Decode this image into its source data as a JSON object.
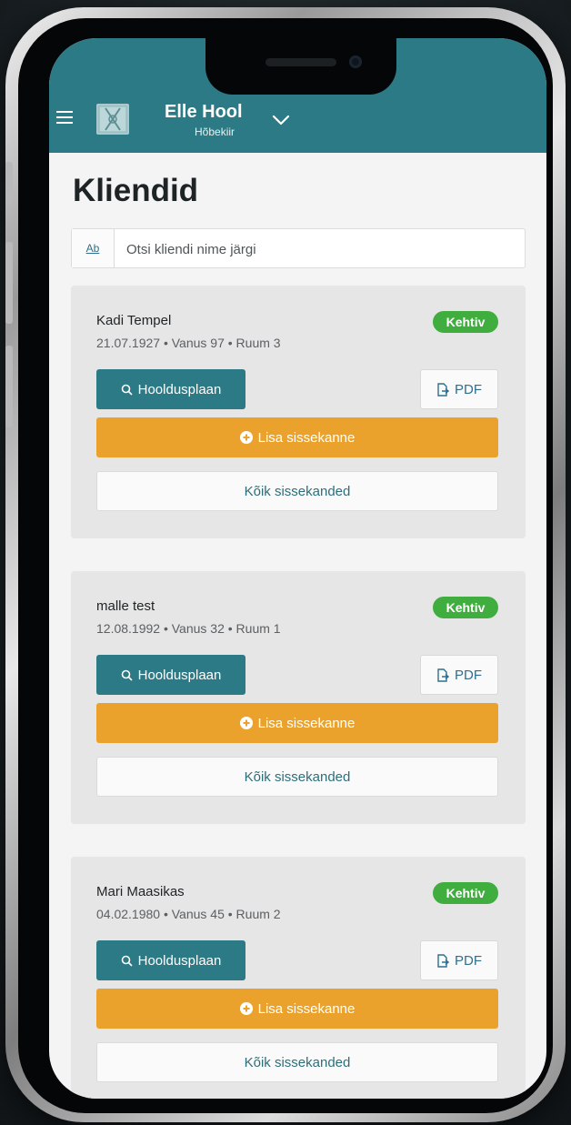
{
  "header": {
    "user_name": "Elle Hool",
    "organization": "Hõbekiir",
    "menu_icon": "hamburger-menu-icon",
    "chevron_icon": "chevron-down-icon",
    "background_color": "#2c7a85"
  },
  "page": {
    "title": "Kliendid"
  },
  "search": {
    "prefix_label": "Ab",
    "placeholder": "Otsi kliendi nime järgi",
    "value": ""
  },
  "clients": [
    {
      "name": "Kadi Tempel",
      "meta": "21.07.1927 • Vanus 97 • Ruum 3",
      "status": "Kehtiv",
      "care_plan_label": "Hooldusplaan",
      "pdf_label": "PDF",
      "add_entry_label": "Lisa sissekanne",
      "all_entries_label": "Kõik sissekanded"
    },
    {
      "name": "malle test",
      "meta": "12.08.1992 • Vanus 32 • Ruum 1",
      "status": "Kehtiv",
      "care_plan_label": "Hooldusplaan",
      "pdf_label": "PDF",
      "add_entry_label": "Lisa sissekanne",
      "all_entries_label": "Kõik sissekanded"
    },
    {
      "name": "Mari Maasikas",
      "meta": "04.02.1980 • Vanus 45 • Ruum 2",
      "status": "Kehtiv",
      "care_plan_label": "Hooldusplaan",
      "pdf_label": "PDF",
      "add_entry_label": "Lisa sissekanne",
      "all_entries_label": "Kõik sissekanded"
    }
  ],
  "colors": {
    "primary": "#2c7a85",
    "accent": "#eba22c",
    "status_active": "#3fae3f"
  }
}
